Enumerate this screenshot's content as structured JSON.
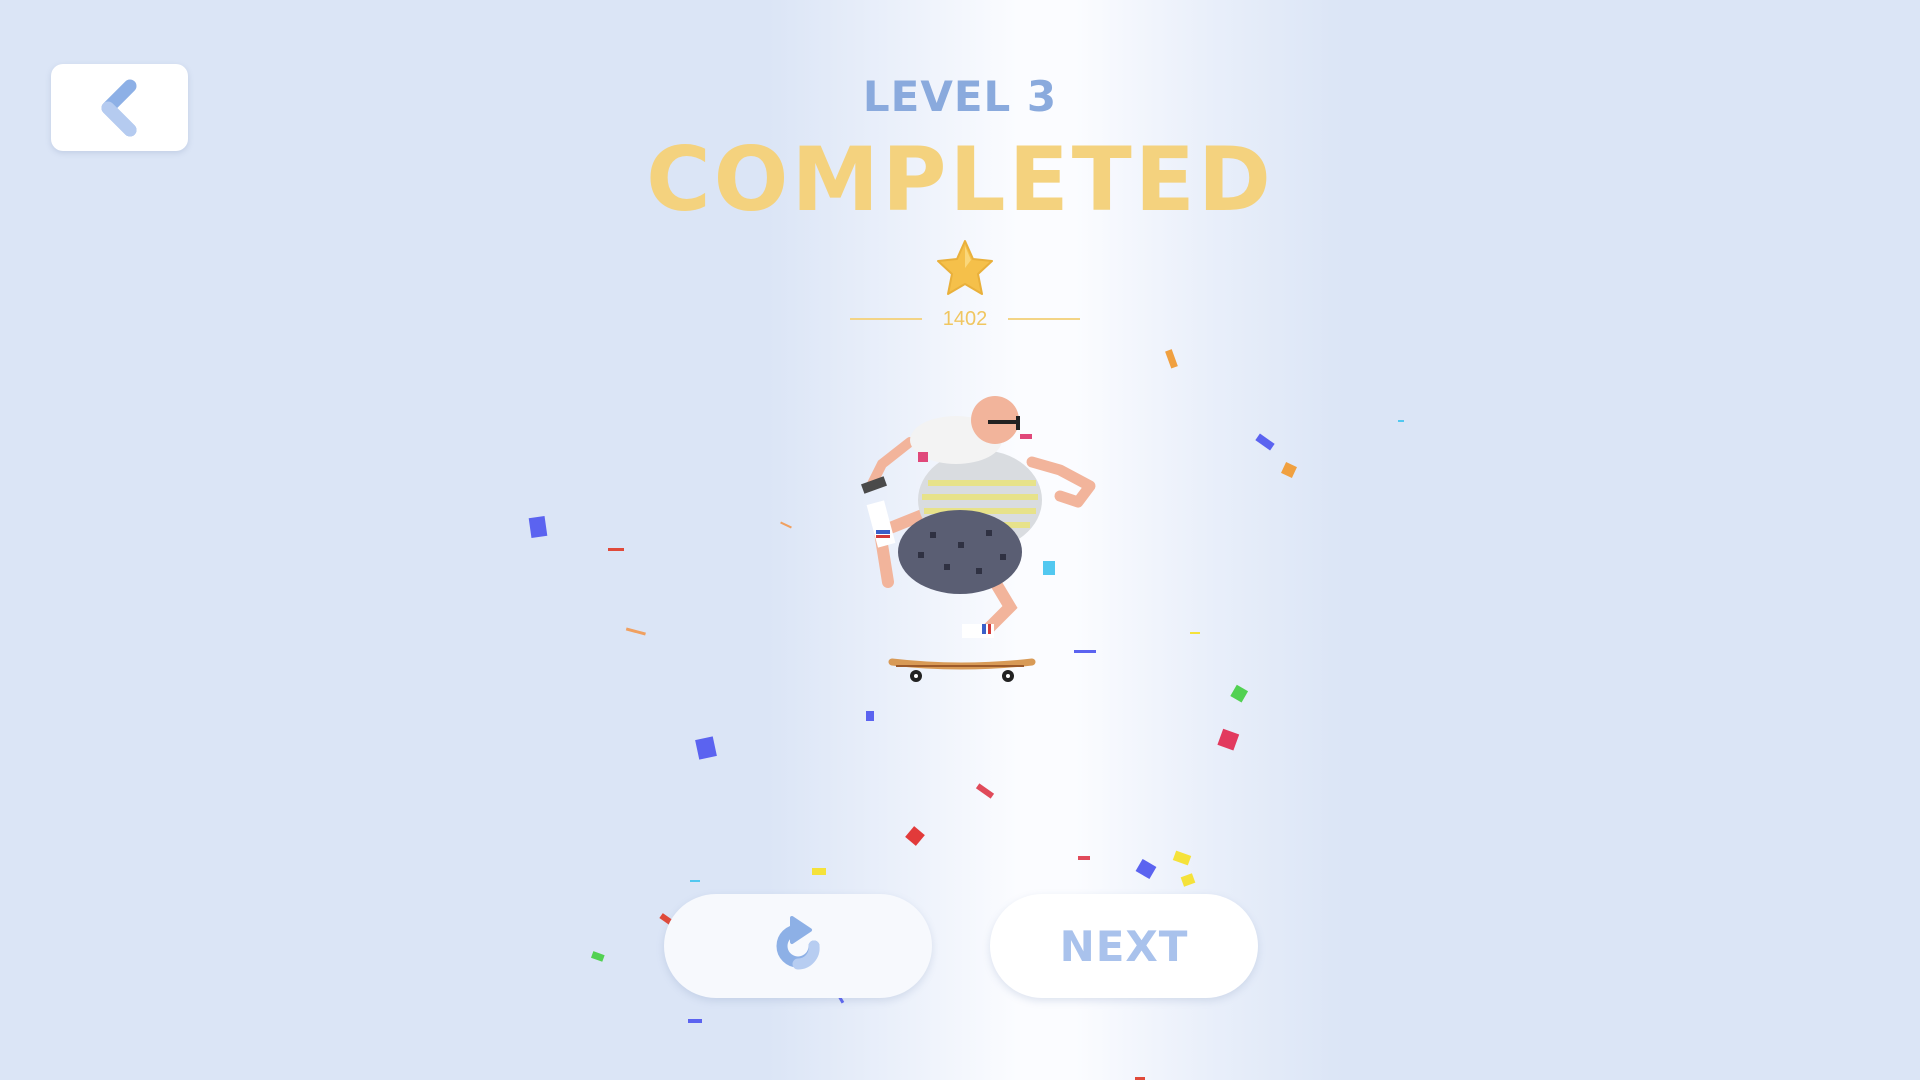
{
  "header": {
    "level_label": "LEVEL 3",
    "status_title": "COMPLETED"
  },
  "score": {
    "stars_earned": 1,
    "value": "1402"
  },
  "buttons": {
    "back_icon": "chevron-left-icon",
    "retry_icon": "restart-icon",
    "next_label": "NEXT"
  },
  "colors": {
    "background": "#dbe5f6",
    "level_text": "#8aaadd",
    "completed_text": "#f4d27e",
    "star": "#f5c04a",
    "score_text": "#f0c660",
    "next_text": "#a9c2ec",
    "icon_blue": "#8db0e6"
  },
  "character": {
    "description_icon": "skateboarder-character"
  }
}
